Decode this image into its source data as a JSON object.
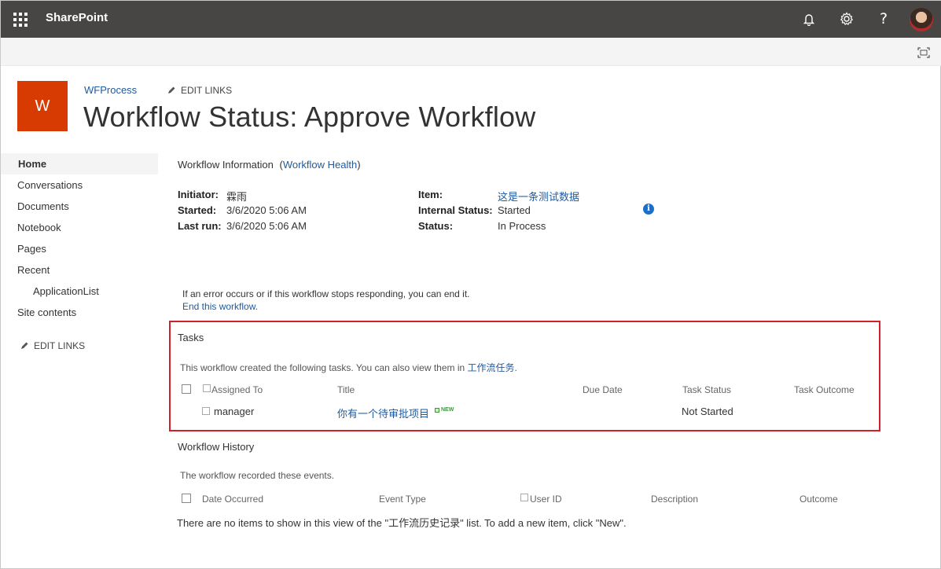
{
  "suitebar": {
    "brand": "SharePoint",
    "icons": [
      "waffle-icon",
      "bell-icon",
      "gear-icon",
      "help-icon",
      "avatar"
    ],
    "help_glyph": "?"
  },
  "header": {
    "logo_letter": "W",
    "breadcrumb": "WFProcess",
    "edit_links": "EDIT LINKS",
    "title": "Workflow Status: Approve Workflow"
  },
  "leftnav": {
    "items": [
      {
        "label": "Home",
        "selected": true
      },
      {
        "label": "Conversations"
      },
      {
        "label": "Documents"
      },
      {
        "label": "Notebook"
      },
      {
        "label": "Pages"
      },
      {
        "label": "Recent"
      },
      {
        "label": "ApplicationList",
        "sub": true
      },
      {
        "label": "Site contents"
      }
    ],
    "edit_links": "EDIT LINKS"
  },
  "workflow_info": {
    "heading": "Workflow Information",
    "health_link": "Workflow Health",
    "paren_open": "(",
    "paren_close": ")",
    "initiator_label": "Initiator:",
    "initiator_value": "霖雨",
    "started_label": "Started:",
    "started_value": "3/6/2020 5:06 AM",
    "lastrun_label": "Last run:",
    "lastrun_value": "3/6/2020 5:06 AM",
    "item_label": "Item:",
    "item_value": "这是一条测试数据",
    "internal_status_label": "Internal Status:",
    "internal_status_value": "Started",
    "status_label": "Status:",
    "status_value": "In Process",
    "info_glyph": "i"
  },
  "end_workflow": {
    "message": "If an error occurs or if this workflow stops responding, you can end it.",
    "link": "End this workflow."
  },
  "tasks": {
    "heading": "Tasks",
    "description": "This workflow created the following tasks. You can also view them in",
    "description_link": "工作流任务",
    "description_end": ".",
    "columns": [
      "Assigned To",
      "Title",
      "Due Date",
      "Task Status",
      "Task Outcome"
    ],
    "rows": [
      {
        "assigned_to": "manager",
        "title": "你有一个待审批项目",
        "badge": "NEW",
        "due_date": "",
        "task_status": "Not Started",
        "task_outcome": ""
      }
    ]
  },
  "history": {
    "heading": "Workflow History",
    "description": "The workflow recorded these events.",
    "columns": [
      "Date Occurred",
      "Event Type",
      "User ID",
      "Description",
      "Outcome"
    ],
    "empty_message": "There are no items to show in this view of the \"工作流历史记录\" list. To add a new item, click \"New\"."
  },
  "colors": {
    "suitebar": "#484644",
    "logo": "#d83b01",
    "link": "#1e5a9e",
    "highlight_border": "#d1202a"
  }
}
